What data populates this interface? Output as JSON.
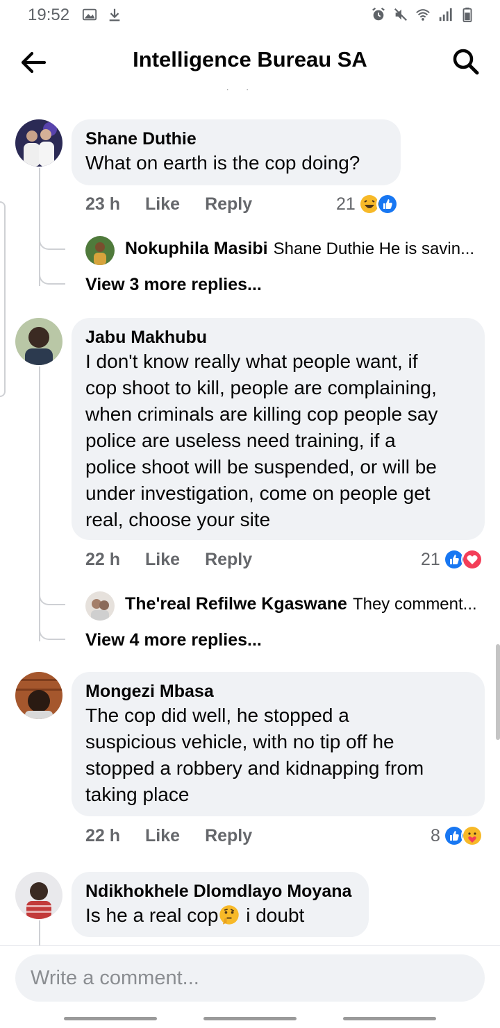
{
  "status_bar": {
    "time": "19:52"
  },
  "header": {
    "title": "Intelligence Bureau SA"
  },
  "comments": [
    {
      "author": "Shane Duthie",
      "text": [
        "What on earth is the cop doing?"
      ],
      "time": "23 h",
      "like_label": "Like",
      "reply_label": "Reply",
      "reaction_count": "21",
      "reactions": [
        "haha",
        "like"
      ],
      "reply_preview": {
        "author": "Nokuphila Masibi",
        "text": "Shane Duthie He is savin..."
      },
      "more_replies": "View 3 more replies..."
    },
    {
      "author": "Jabu Makhubu",
      "text": [
        "I don't know really what people want, if",
        "cop shoot to kill, people are complaining,",
        "when criminals are killing cop people say",
        "police are useless need training, if a",
        "police shoot will be suspended, or will be",
        "under investigation, come on people get",
        "real, choose your site"
      ],
      "time": "22 h",
      "like_label": "Like",
      "reply_label": "Reply",
      "reaction_count": "21",
      "reactions": [
        "like",
        "love"
      ],
      "reply_preview": {
        "author": "The'real Refilwe Kgaswane",
        "text": "They comment..."
      },
      "more_replies": "View 4 more replies..."
    },
    {
      "author": "Mongezi Mbasa",
      "text": [
        "The cop did well, he stopped a",
        "suspicious vehicle, with no tip off he",
        "stopped a robbery and kidnapping from",
        "taking place"
      ],
      "time": "22 h",
      "like_label": "Like",
      "reply_label": "Reply",
      "reaction_count": "8",
      "reactions": [
        "like",
        "care"
      ]
    },
    {
      "author": "Ndikhokhele Dlomdlayo Moyana",
      "text_before": "Is he a real cop",
      "text_after": " i doubt"
    }
  ],
  "composer": {
    "placeholder": "Write a comment..."
  },
  "colors": {
    "like_blue": "#1877f2",
    "love_red": "#f33e58",
    "emoji_yellow": "#f7b928",
    "bubble": "#f0f2f5",
    "meta_gray": "#65676b"
  },
  "icons": [
    "back-arrow-icon",
    "search-icon",
    "gallery-icon",
    "download-icon",
    "alarm-icon",
    "mute-icon",
    "wifi-icon",
    "signal-icon",
    "battery-icon"
  ]
}
